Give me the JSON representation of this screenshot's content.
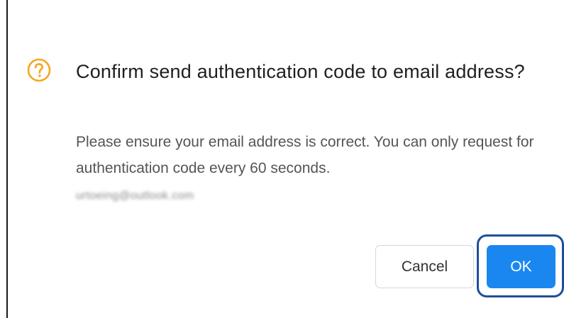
{
  "dialog": {
    "title": "Confirm send authentication code to email address?",
    "message": "Please ensure your email address is correct. You can only request for authentication code every 60 seconds.",
    "email": "urtoeing@outlook.com",
    "icon": "question-circle-icon",
    "icon_color": "#f5a623",
    "buttons": {
      "cancel_label": "Cancel",
      "ok_label": "OK"
    },
    "colors": {
      "primary": "#1a87f0",
      "focus_ring": "#1d4f9a"
    }
  }
}
